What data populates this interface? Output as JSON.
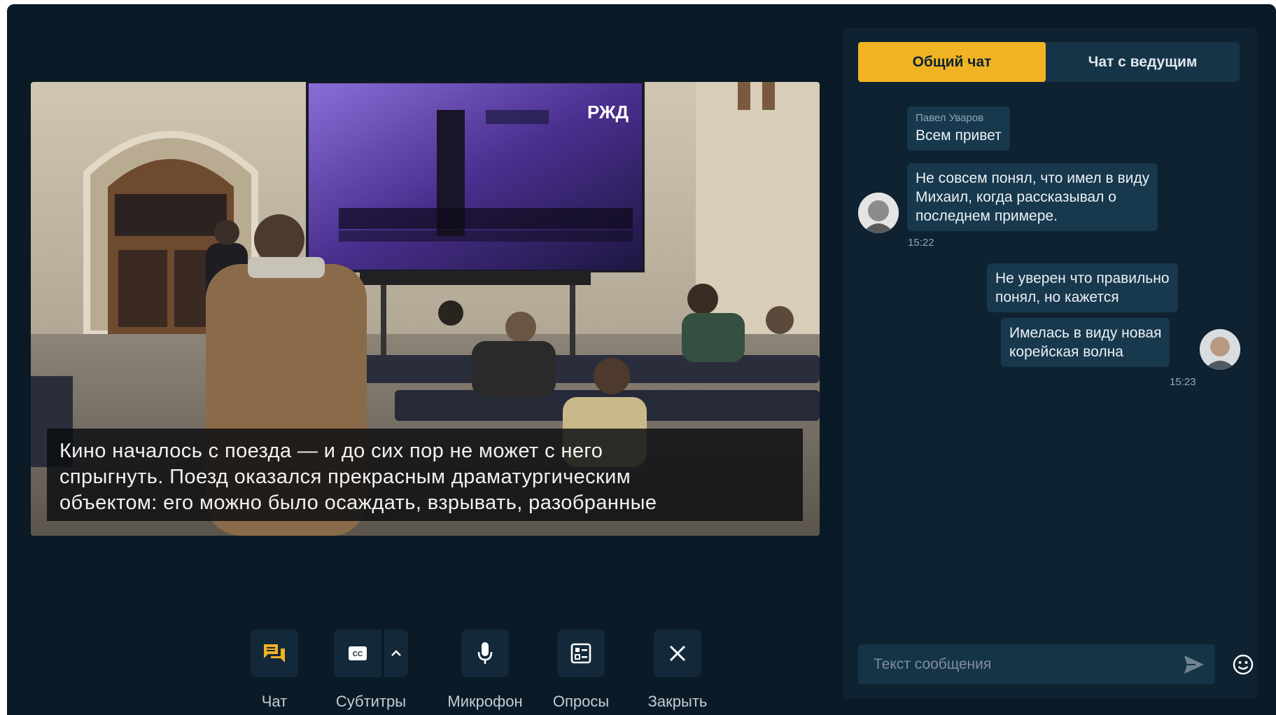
{
  "video": {
    "screen_logo": "РЖД",
    "subtitles": [
      "Кино началось с поезда — и до сих пор не может с него",
      "спрыгнуть. Поезд оказался прекрасным драматургическим",
      "объектом: его можно было осаждать, взрывать, разобранные"
    ]
  },
  "controls": {
    "chat": "Чат",
    "subtitles": "Субтитры",
    "microphone": "Микрофон",
    "polls": "Опросы",
    "close": "Закрыть"
  },
  "chat": {
    "tabs": {
      "general": "Общий чат",
      "host": "Чат с ведущим"
    },
    "messages": [
      {
        "author": "Павел Уваров",
        "lines": [
          "Всем привет"
        ]
      },
      {
        "lines": [
          "Не совсем понял, что имел в виду",
          "Михаил, когда рассказывал о",
          "последнем примере."
        ],
        "time": "15:22"
      },
      {
        "lines": [
          "Не уверен что правильно",
          "понял, но кажется"
        ]
      },
      {
        "lines": [
          "Имелась в виду новая",
          "корейская волна"
        ],
        "time": "15:23"
      }
    ],
    "input_placeholder": "Текст сообщения"
  },
  "colors": {
    "background": "#0a1a26",
    "panel": "#0f2231",
    "bubble": "#17384d",
    "accent": "#f0b323"
  },
  "icons": [
    "chat-icon",
    "cc-icon",
    "chevron-up-icon",
    "microphone-icon",
    "poll-icon",
    "close-icon",
    "send-icon",
    "emoji-icon"
  ]
}
